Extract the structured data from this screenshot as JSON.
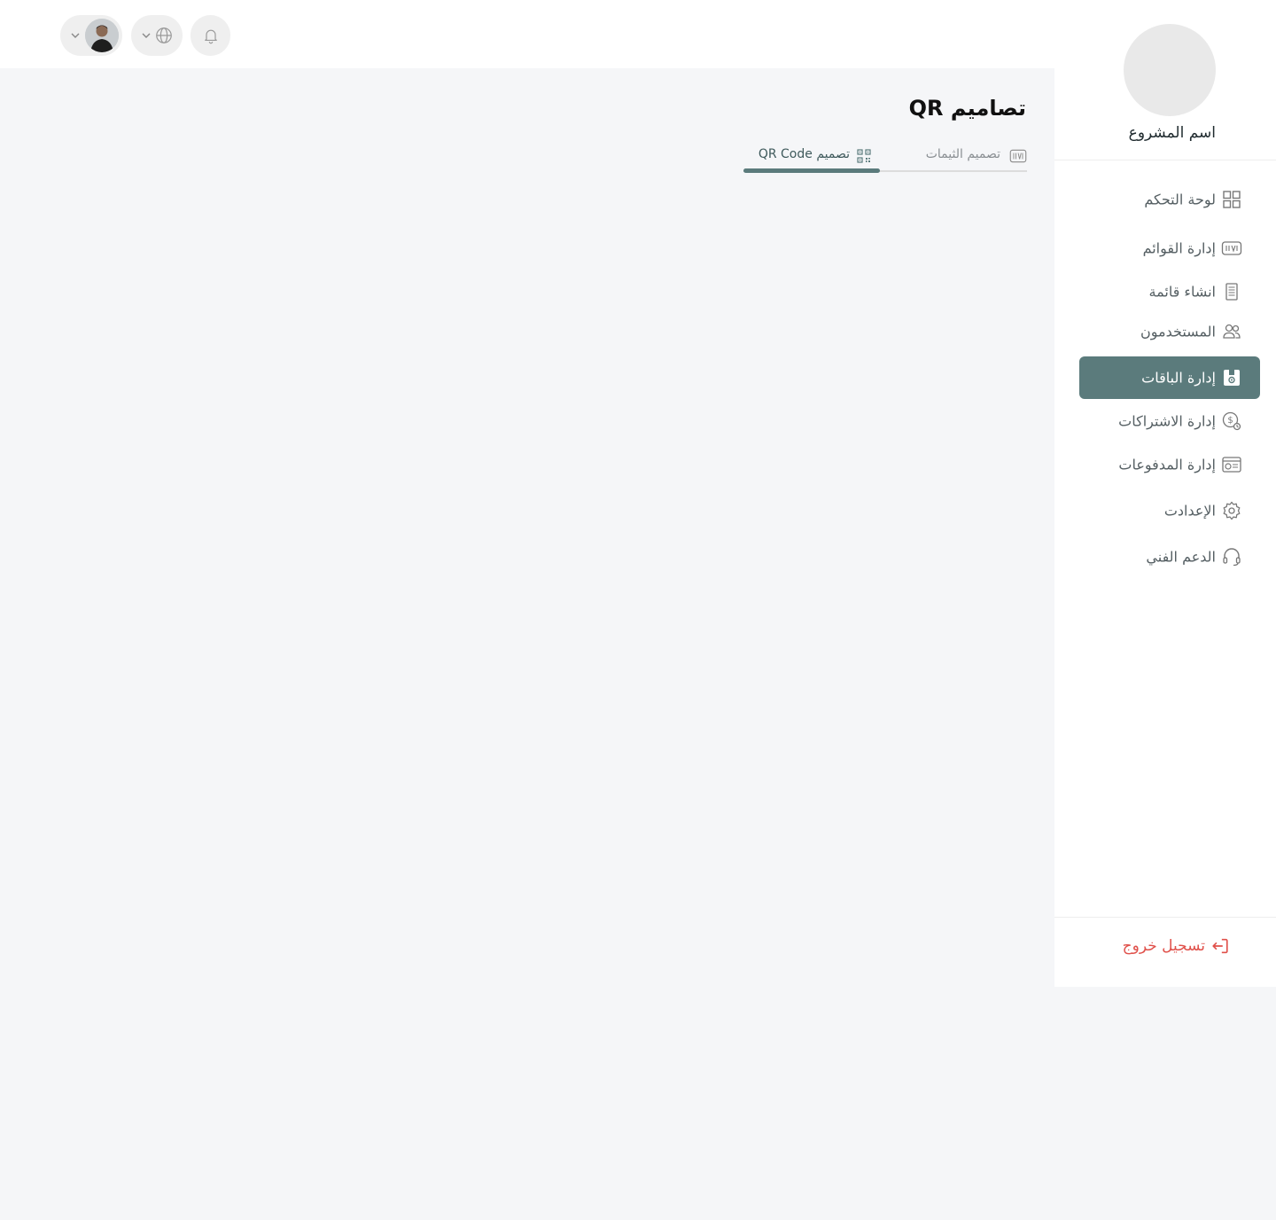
{
  "header": {
    "user_avatar_alt": "user avatar",
    "language_icon": "globe-icon",
    "notification_icon": "bell-icon"
  },
  "sidebar": {
    "project_name": "اسم المشروع",
    "items": [
      {
        "label": "لوحة التحكم",
        "icon": "grid-icon",
        "active": false
      },
      {
        "label": "إدارة القوائم",
        "icon": "menu-list-icon",
        "active": false
      },
      {
        "label": "انشاء قائمة",
        "icon": "document-icon",
        "active": false
      },
      {
        "label": "المستخدمون",
        "icon": "users-icon",
        "active": false
      },
      {
        "label": "إدارة الباقات",
        "icon": "package-icon",
        "active": true
      },
      {
        "label": "إدارة الاشتراكات",
        "icon": "subscription-icon",
        "active": false
      },
      {
        "label": "إدارة المدفوعات",
        "icon": "payments-icon",
        "active": false
      },
      {
        "label": "الإعدادت",
        "icon": "gear-icon",
        "active": false
      },
      {
        "label": "الدعم الفني",
        "icon": "headset-icon",
        "active": false
      }
    ],
    "logout_label": "تسجيل خروج"
  },
  "main": {
    "title": "تصاميم QR",
    "tabs": [
      {
        "label": "تصميم الثيمات",
        "icon": "theme-icon",
        "active": false
      },
      {
        "label": "تصميم QR Code",
        "icon": "qr-code-icon",
        "active": true
      }
    ]
  },
  "colors": {
    "accent": "#5b7b7c",
    "logout": "#e0504a",
    "background": "#f5f6f8"
  }
}
